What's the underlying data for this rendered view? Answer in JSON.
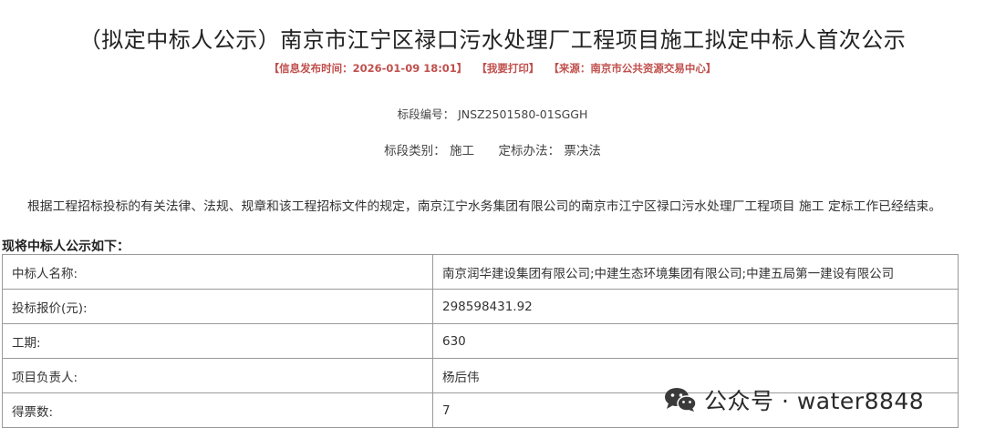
{
  "header": {
    "title": "（拟定中标人公示）南京市江宁区禄口污水处理厂工程项目施工拟定中标人首次公示",
    "meta": {
      "publish_time": "【信息发布时间：2026-01-09 18:01】",
      "print": "【我要打印】",
      "source": "【来源：南京市公共资源交易中心】"
    }
  },
  "section": {
    "number_line": "标段编号： JNSZ2501580-01SGGH",
    "type_label": "标段类别：",
    "type_value": "施工",
    "method_label": "定标办法：",
    "method_value": "票决法"
  },
  "body": {
    "paragraph": "根据工程招标投标的有关法律、法规、规章和该工程招标文件的规定，南京江宁水务集团有限公司的南京市江宁区禄口污水处理厂工程项目 施工 定标工作已经结束。",
    "announce": "现将中标人公示如下："
  },
  "table": {
    "rows": [
      {
        "label": "中标人名称:",
        "value": "南京润华建设集团有限公司;中建生态环境集团有限公司;中建五局第一建设有限公司"
      },
      {
        "label": "投标报价(元):",
        "value": "298598431.92"
      },
      {
        "label": "工期:",
        "value": "630"
      },
      {
        "label": "项目负责人:",
        "value": "杨后伟"
      },
      {
        "label": "得票数:",
        "value": "7"
      }
    ]
  },
  "watermark": {
    "icon": "wechat-icon",
    "text": "公众号 · water8848"
  }
}
